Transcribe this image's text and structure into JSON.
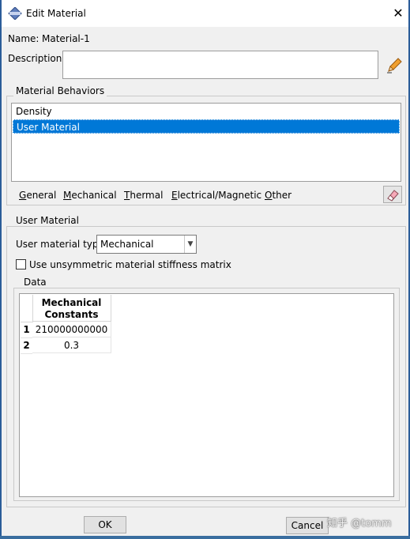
{
  "window": {
    "title": "Edit Material",
    "close_symbol": "✕"
  },
  "name": {
    "label": "Name:",
    "value": "Material-1"
  },
  "description": {
    "label": "Description:",
    "value": ""
  },
  "behaviors": {
    "title": "Material Behaviors",
    "items": [
      {
        "label": "Density",
        "selected": false
      },
      {
        "label": "User Material",
        "selected": true
      }
    ]
  },
  "menu": [
    {
      "label": "General",
      "mnemonic": "G"
    },
    {
      "label": "Mechanical",
      "mnemonic": "M"
    },
    {
      "label": "Thermal",
      "mnemonic": "T"
    },
    {
      "label": "Electrical/Magnetic",
      "mnemonic": "E"
    },
    {
      "label": "Other",
      "mnemonic": "O"
    }
  ],
  "user_material": {
    "title": "User Material",
    "type_label": "User material type:",
    "type_value": "Mechanical",
    "unsymmetric_label": "Use unsymmetric material stiffness matrix",
    "unsymmetric_checked": false
  },
  "data": {
    "title": "Data",
    "column_header_line1": "Mechanical",
    "column_header_line2": "Constants",
    "rows": [
      {
        "num": "1",
        "value": "210000000000"
      },
      {
        "num": "2",
        "value": "0.3"
      }
    ]
  },
  "buttons": {
    "ok": "OK",
    "cancel": "Cancel"
  },
  "watermark": "知乎 @tomm",
  "colors": {
    "selection": "#0078d7",
    "frame": "#2b5d99"
  },
  "icons": {
    "app": "abaqus-material-icon",
    "edit": "pencil-icon",
    "clear": "eraser-icon"
  }
}
